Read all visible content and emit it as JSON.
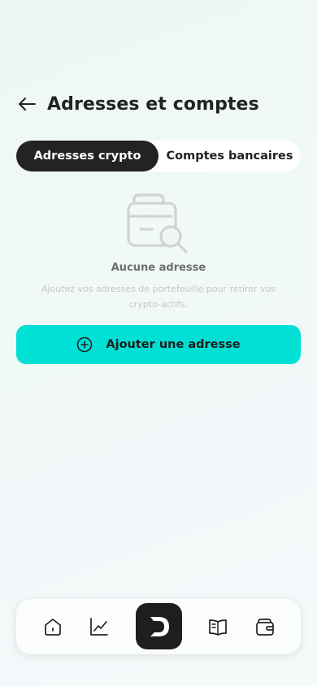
{
  "header": {
    "title": "Adresses et comptes",
    "back_icon": "arrow-left-icon"
  },
  "tabs": [
    {
      "label": "Adresses crypto",
      "active": true
    },
    {
      "label": "Comptes bancaires",
      "active": false
    }
  ],
  "empty_state": {
    "icon": "wallet-search-icon",
    "title": "Aucune adresse",
    "description": "Ajoutez vos adresses de portefeuille pour retirer vos crypto-actifs."
  },
  "add_button": {
    "label": "Ajouter une adresse",
    "icon": "plus-circle-icon"
  },
  "bottom_nav": {
    "items": [
      {
        "icon": "home-icon"
      },
      {
        "icon": "chart-icon"
      },
      {
        "icon": "logo-d-icon",
        "active": true
      },
      {
        "icon": "book-icon"
      },
      {
        "icon": "wallet-icon"
      }
    ]
  },
  "colors": {
    "accent": "#00e0d4",
    "dark": "#232323",
    "background": "#eef7f6"
  }
}
